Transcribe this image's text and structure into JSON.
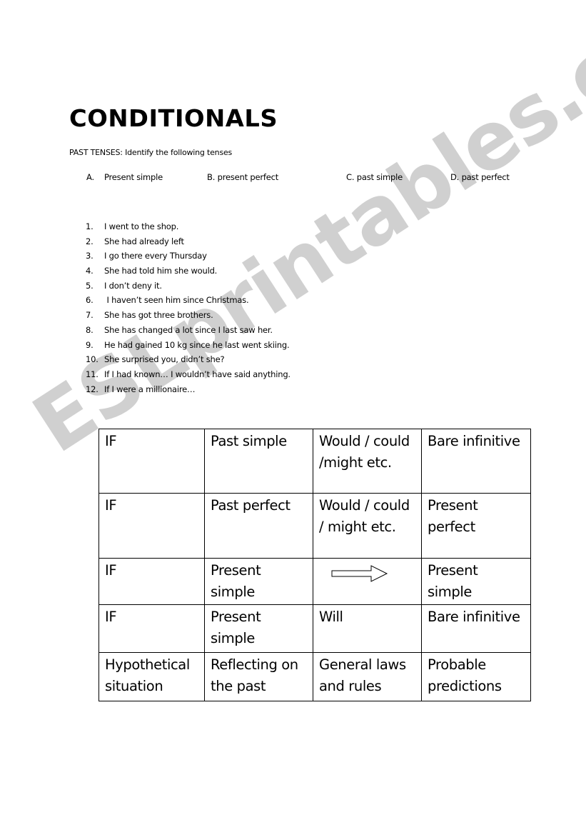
{
  "title": "CONDITIONALS",
  "instruction": "PAST TENSES: Identify the following tenses",
  "options": [
    {
      "letter": "A.",
      "label": "Present simple"
    },
    {
      "letter": "",
      "label": "B. present perfect"
    },
    {
      "letter": "",
      "label": "C. past simple"
    },
    {
      "letter": "",
      "label": "D. past perfect"
    }
  ],
  "sentences": [
    {
      "num": "1.",
      "text": "I went to the shop."
    },
    {
      "num": "2.",
      "text": "She had already left"
    },
    {
      "num": "3.",
      "text": "I go there every Thursday"
    },
    {
      "num": "4.",
      "text": "She had told him she would."
    },
    {
      "num": "5.",
      "text": "I don’t deny it."
    },
    {
      "num": "6.",
      "text": " I haven’t seen him since Christmas."
    },
    {
      "num": "7.",
      "text": "She has got three brothers."
    },
    {
      "num": "8.",
      "text": "She has changed a lot since I last saw her."
    },
    {
      "num": "9.",
      "text": "He had gained 10 kg since he last went skiing."
    },
    {
      "num": "10.",
      "text": "She surprised you, didn’t she?"
    },
    {
      "num": "11.",
      "text": "If I had known… I wouldn’t have said anything."
    },
    {
      "num": "12.",
      "text": "If I were a millionaire…"
    }
  ],
  "table": {
    "rows": [
      [
        "IF",
        "Past simple",
        "Would / could /might etc.",
        "Bare infinitive"
      ],
      [
        "IF",
        "Past perfect",
        "Would / could / might etc.",
        "Present perfect"
      ],
      [
        "IF",
        "Present simple",
        "",
        "Present simple"
      ],
      [
        "IF",
        "Present simple",
        "Will",
        "Bare infinitive"
      ],
      [
        "Hypothetical situation",
        "Reflecting on the past",
        "General laws and rules",
        "Probable predictions"
      ]
    ],
    "arrow_icon": "right-arrow-icon"
  },
  "watermark": "ESLprintables.com",
  "colors": {
    "watermark": "#c8c8c8",
    "text": "#000000",
    "border": "#000000"
  }
}
